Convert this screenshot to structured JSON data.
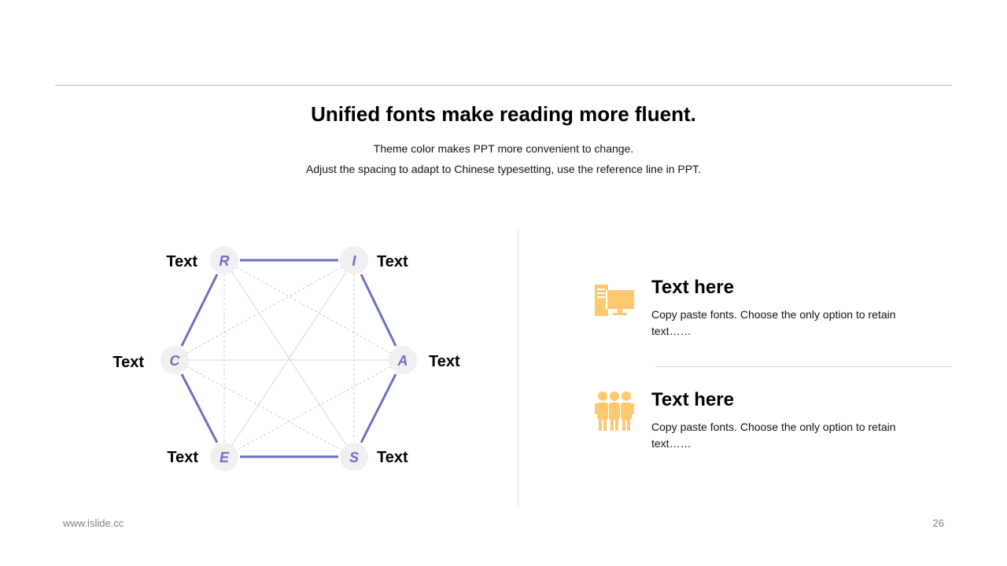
{
  "header": {
    "title": "Unified fonts make reading more fluent.",
    "subtitle_line1": "Theme color makes PPT more convenient to change.",
    "subtitle_line2": "Adjust the spacing to adapt to Chinese typesetting, use the reference line in PPT."
  },
  "diagram": {
    "accent_color": "#6b6fc8",
    "node_fill": "#f0f0f2",
    "nodes": [
      {
        "letter": "R",
        "label": "Text"
      },
      {
        "letter": "I",
        "label": "Text"
      },
      {
        "letter": "A",
        "label": "Text"
      },
      {
        "letter": "S",
        "label": "Text"
      },
      {
        "letter": "E",
        "label": "Text"
      },
      {
        "letter": "C",
        "label": "Text"
      }
    ]
  },
  "items": [
    {
      "icon": "computer-icon",
      "title": "Text here",
      "desc": "Copy paste fonts. Choose the only option to retain text……"
    },
    {
      "icon": "team-icon",
      "title": "Text here",
      "desc": "Copy paste fonts. Choose the only option to retain text……"
    }
  ],
  "icon_color": "#ffc86e",
  "footer": {
    "site": "www.islide.cc",
    "page_number": "26"
  }
}
